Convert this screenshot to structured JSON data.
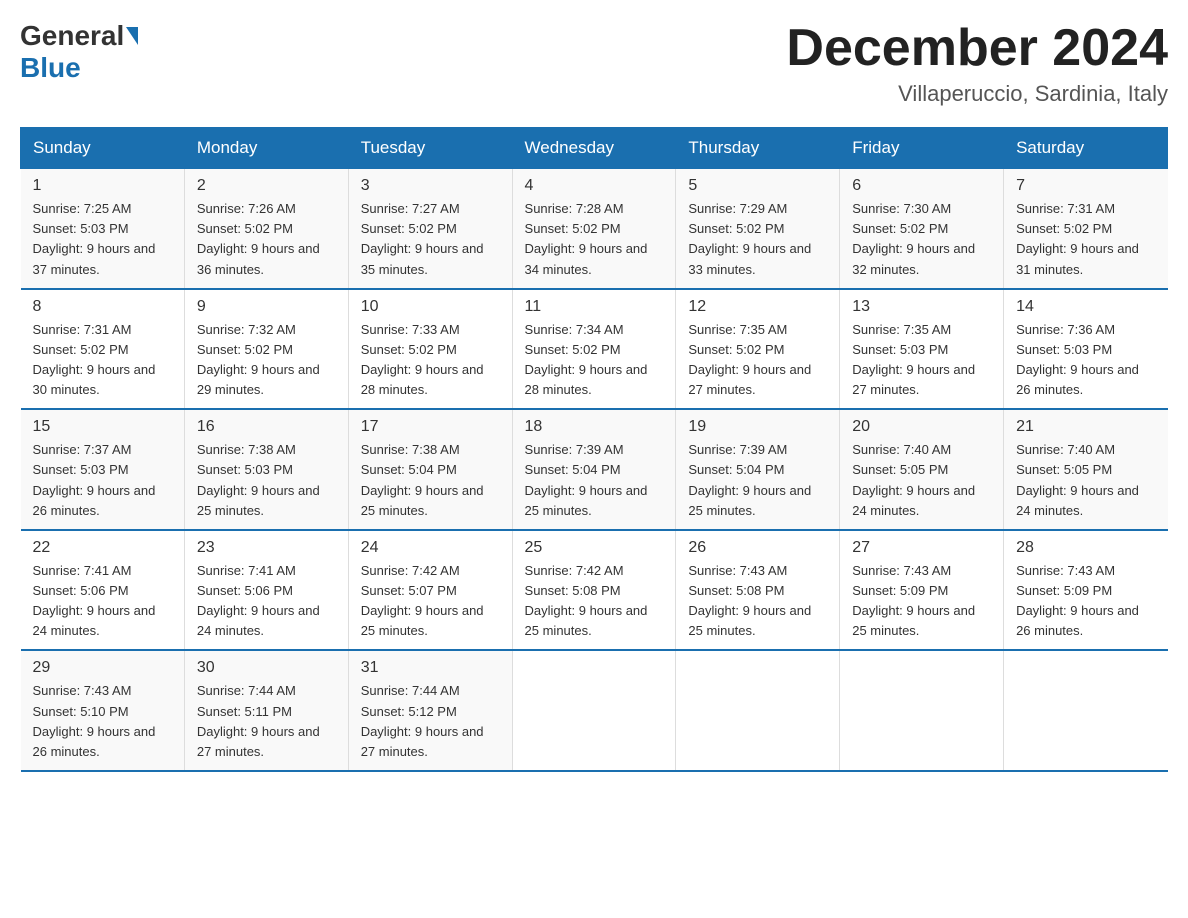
{
  "header": {
    "logo_general": "General",
    "logo_blue": "Blue",
    "month_title": "December 2024",
    "location": "Villaperuccio, Sardinia, Italy"
  },
  "days_of_week": [
    "Sunday",
    "Monday",
    "Tuesday",
    "Wednesday",
    "Thursday",
    "Friday",
    "Saturday"
  ],
  "weeks": [
    [
      {
        "day": "1",
        "sunrise": "7:25 AM",
        "sunset": "5:03 PM",
        "daylight": "9 hours and 37 minutes."
      },
      {
        "day": "2",
        "sunrise": "7:26 AM",
        "sunset": "5:02 PM",
        "daylight": "9 hours and 36 minutes."
      },
      {
        "day": "3",
        "sunrise": "7:27 AM",
        "sunset": "5:02 PM",
        "daylight": "9 hours and 35 minutes."
      },
      {
        "day": "4",
        "sunrise": "7:28 AM",
        "sunset": "5:02 PM",
        "daylight": "9 hours and 34 minutes."
      },
      {
        "day": "5",
        "sunrise": "7:29 AM",
        "sunset": "5:02 PM",
        "daylight": "9 hours and 33 minutes."
      },
      {
        "day": "6",
        "sunrise": "7:30 AM",
        "sunset": "5:02 PM",
        "daylight": "9 hours and 32 minutes."
      },
      {
        "day": "7",
        "sunrise": "7:31 AM",
        "sunset": "5:02 PM",
        "daylight": "9 hours and 31 minutes."
      }
    ],
    [
      {
        "day": "8",
        "sunrise": "7:31 AM",
        "sunset": "5:02 PM",
        "daylight": "9 hours and 30 minutes."
      },
      {
        "day": "9",
        "sunrise": "7:32 AM",
        "sunset": "5:02 PM",
        "daylight": "9 hours and 29 minutes."
      },
      {
        "day": "10",
        "sunrise": "7:33 AM",
        "sunset": "5:02 PM",
        "daylight": "9 hours and 28 minutes."
      },
      {
        "day": "11",
        "sunrise": "7:34 AM",
        "sunset": "5:02 PM",
        "daylight": "9 hours and 28 minutes."
      },
      {
        "day": "12",
        "sunrise": "7:35 AM",
        "sunset": "5:02 PM",
        "daylight": "9 hours and 27 minutes."
      },
      {
        "day": "13",
        "sunrise": "7:35 AM",
        "sunset": "5:03 PM",
        "daylight": "9 hours and 27 minutes."
      },
      {
        "day": "14",
        "sunrise": "7:36 AM",
        "sunset": "5:03 PM",
        "daylight": "9 hours and 26 minutes."
      }
    ],
    [
      {
        "day": "15",
        "sunrise": "7:37 AM",
        "sunset": "5:03 PM",
        "daylight": "9 hours and 26 minutes."
      },
      {
        "day": "16",
        "sunrise": "7:38 AM",
        "sunset": "5:03 PM",
        "daylight": "9 hours and 25 minutes."
      },
      {
        "day": "17",
        "sunrise": "7:38 AM",
        "sunset": "5:04 PM",
        "daylight": "9 hours and 25 minutes."
      },
      {
        "day": "18",
        "sunrise": "7:39 AM",
        "sunset": "5:04 PM",
        "daylight": "9 hours and 25 minutes."
      },
      {
        "day": "19",
        "sunrise": "7:39 AM",
        "sunset": "5:04 PM",
        "daylight": "9 hours and 25 minutes."
      },
      {
        "day": "20",
        "sunrise": "7:40 AM",
        "sunset": "5:05 PM",
        "daylight": "9 hours and 24 minutes."
      },
      {
        "day": "21",
        "sunrise": "7:40 AM",
        "sunset": "5:05 PM",
        "daylight": "9 hours and 24 minutes."
      }
    ],
    [
      {
        "day": "22",
        "sunrise": "7:41 AM",
        "sunset": "5:06 PM",
        "daylight": "9 hours and 24 minutes."
      },
      {
        "day": "23",
        "sunrise": "7:41 AM",
        "sunset": "5:06 PM",
        "daylight": "9 hours and 24 minutes."
      },
      {
        "day": "24",
        "sunrise": "7:42 AM",
        "sunset": "5:07 PM",
        "daylight": "9 hours and 25 minutes."
      },
      {
        "day": "25",
        "sunrise": "7:42 AM",
        "sunset": "5:08 PM",
        "daylight": "9 hours and 25 minutes."
      },
      {
        "day": "26",
        "sunrise": "7:43 AM",
        "sunset": "5:08 PM",
        "daylight": "9 hours and 25 minutes."
      },
      {
        "day": "27",
        "sunrise": "7:43 AM",
        "sunset": "5:09 PM",
        "daylight": "9 hours and 25 minutes."
      },
      {
        "day": "28",
        "sunrise": "7:43 AM",
        "sunset": "5:09 PM",
        "daylight": "9 hours and 26 minutes."
      }
    ],
    [
      {
        "day": "29",
        "sunrise": "7:43 AM",
        "sunset": "5:10 PM",
        "daylight": "9 hours and 26 minutes."
      },
      {
        "day": "30",
        "sunrise": "7:44 AM",
        "sunset": "5:11 PM",
        "daylight": "9 hours and 27 minutes."
      },
      {
        "day": "31",
        "sunrise": "7:44 AM",
        "sunset": "5:12 PM",
        "daylight": "9 hours and 27 minutes."
      },
      null,
      null,
      null,
      null
    ]
  ]
}
